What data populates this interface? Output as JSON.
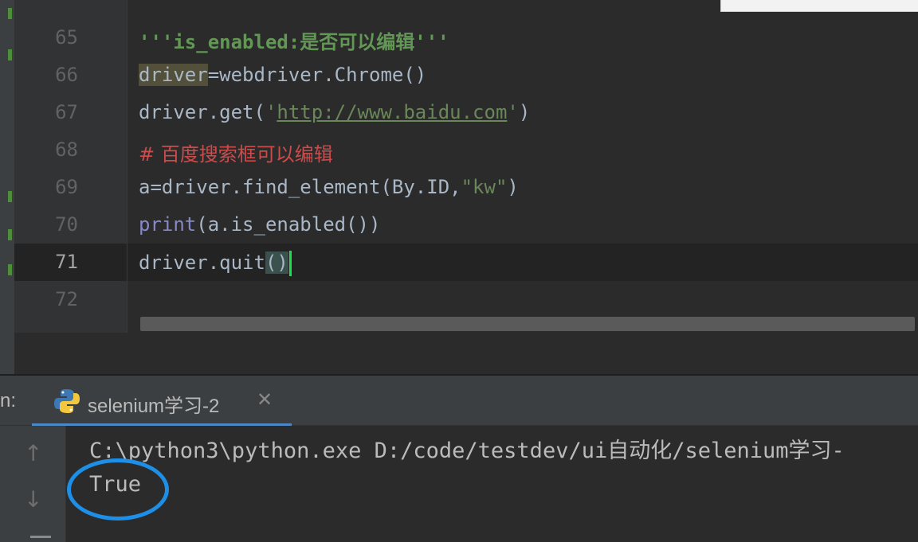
{
  "editor": {
    "lines": [
      {
        "n": "65",
        "text": "'''is_enabled:是否可以编辑'''"
      },
      {
        "n": "66",
        "v": "driver",
        "eq": "=",
        "rest": "webdriver.Chrome()"
      },
      {
        "n": "67",
        "pre": "driver.get(",
        "q1": "'",
        "url": "http://www.baidu.com",
        "q2": "'",
        "post": ")"
      },
      {
        "n": "68",
        "text": "# 百度搜索框可以编辑"
      },
      {
        "n": "69",
        "a": "a",
        "eq": "=",
        "pre": "driver.find_element(By.ID",
        "comma": ",",
        "str": "\"kw\"",
        "post": ")"
      },
      {
        "n": "70",
        "kw": "print",
        "rest": "(a.is_enabled())"
      },
      {
        "n": "71",
        "pre": "driver.quit",
        "brace": "()"
      },
      {
        "n": "72"
      }
    ]
  },
  "run_panel": {
    "label": "n:",
    "tab_label": "selenium学习-2",
    "close_glyph": "✕"
  },
  "console": {
    "command": "C:\\python3\\python.exe D:/code/testdev/ui自动化/selenium学习-",
    "output": "True",
    "up_glyph": "↑",
    "down_glyph": "↓"
  },
  "colors": {
    "keyword": "#8888c6",
    "docstring": "#629755",
    "comment": "#cc4b4b",
    "annotation_circle": "#1e8fe6",
    "caret": "#18e44a"
  }
}
